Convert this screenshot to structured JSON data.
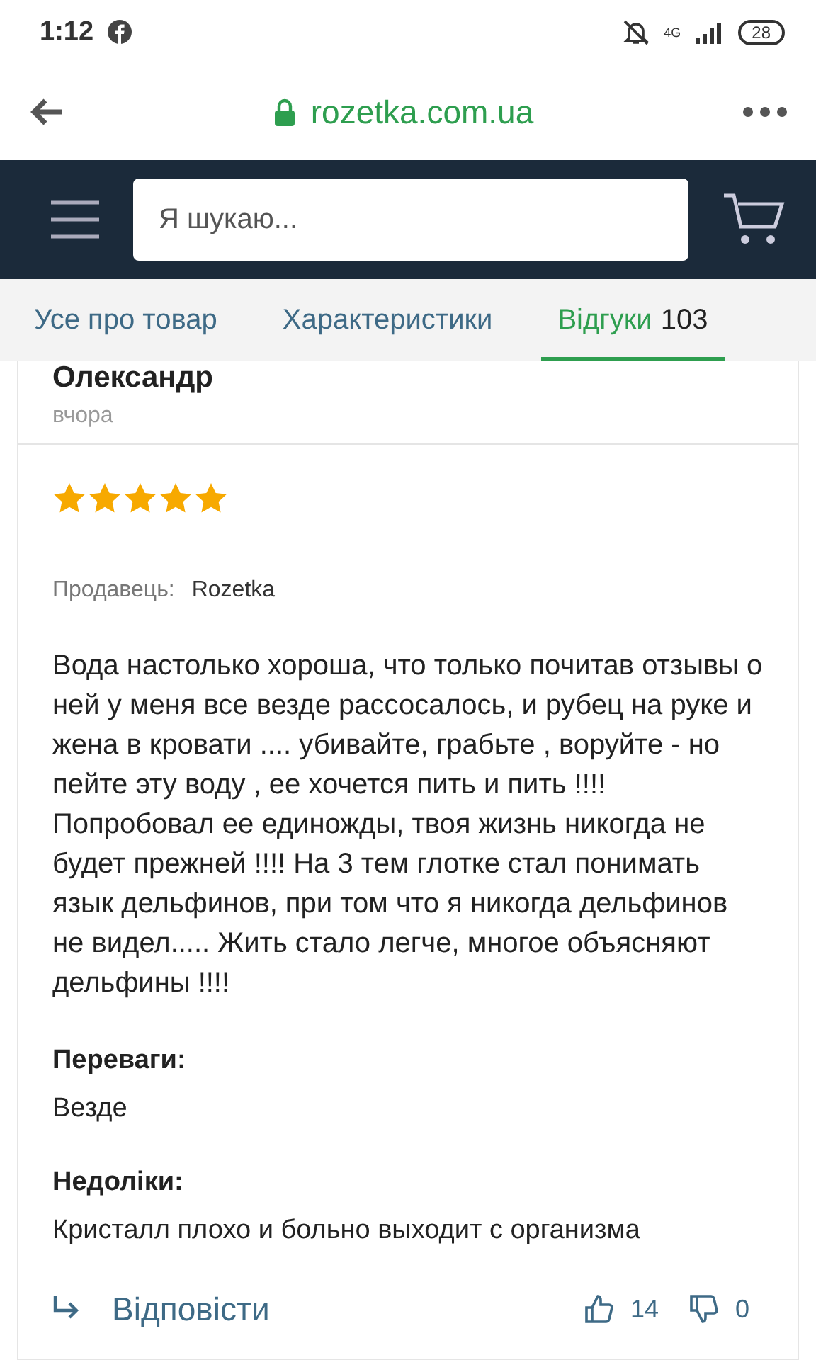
{
  "status_bar": {
    "time": "1:12",
    "network": "4G",
    "battery": "28"
  },
  "browser": {
    "url": "rozetka.com.ua"
  },
  "header": {
    "search": {
      "placeholder": "Я шукаю..."
    }
  },
  "tabs": [
    {
      "label": "Усе про товар",
      "selected": false
    },
    {
      "label": "Характеристики",
      "selected": false
    },
    {
      "label": "Відгуки",
      "count": "103",
      "selected": true
    }
  ],
  "review": {
    "author": "Олександр",
    "date": "вчора",
    "stars": 5,
    "seller_label": "Продавець:",
    "seller": "Rozetka",
    "text": "Вода настолько хороша, что только почитав отзывы о ней у меня все везде рассосалось, и рубец на руке и жена в кровати .... убивайте, грабьте , воруйте - но пейте эту воду , ее хочется пить и пить !!!! Попробовал ее единожды, твоя жизнь никогда не будет прежней !!!! На 3 тем глотке стал понимать язык дельфинов, при том что я никогда дельфинов не видел..... Жить стало легче, многое объясняют дельфины !!!!",
    "pros_label": "Переваги:",
    "pros": "Везде",
    "cons_label": "Недоліки:",
    "cons": "Кристалл плохо и больно выходит с организма",
    "reply": "Відповісти",
    "likes": "14",
    "dislikes": "0"
  }
}
